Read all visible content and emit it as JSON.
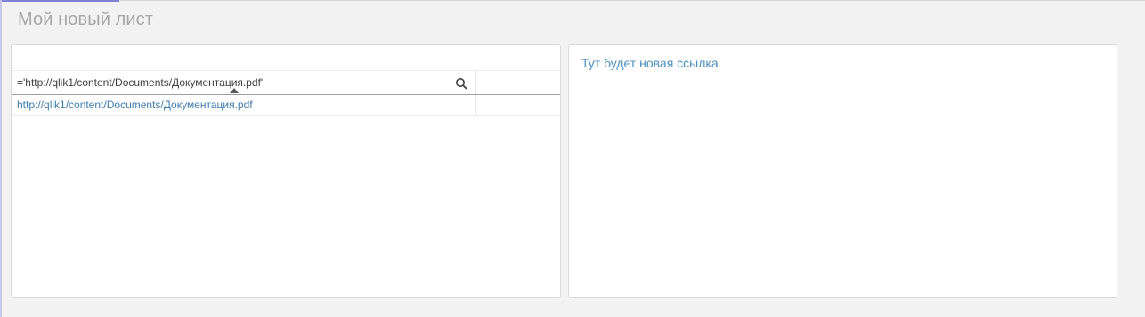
{
  "sheet": {
    "title": "Мой новый лист"
  },
  "table": {
    "column_header": "='http://qlik1/content/Documents/Документация.pdf'",
    "rows": [
      {
        "link": "http://qlik1/content/Documents/Документация.pdf"
      }
    ]
  },
  "text_object": {
    "text": "Тут будет новая ссылка"
  },
  "colors": {
    "link": "#3f7cad",
    "text_accent": "#4b8fbf",
    "title": "#a6a6a6",
    "background": "#f2f2f2"
  },
  "icons": {
    "header_search": "search-icon",
    "sort_indicator": "sort-ascending-icon"
  }
}
